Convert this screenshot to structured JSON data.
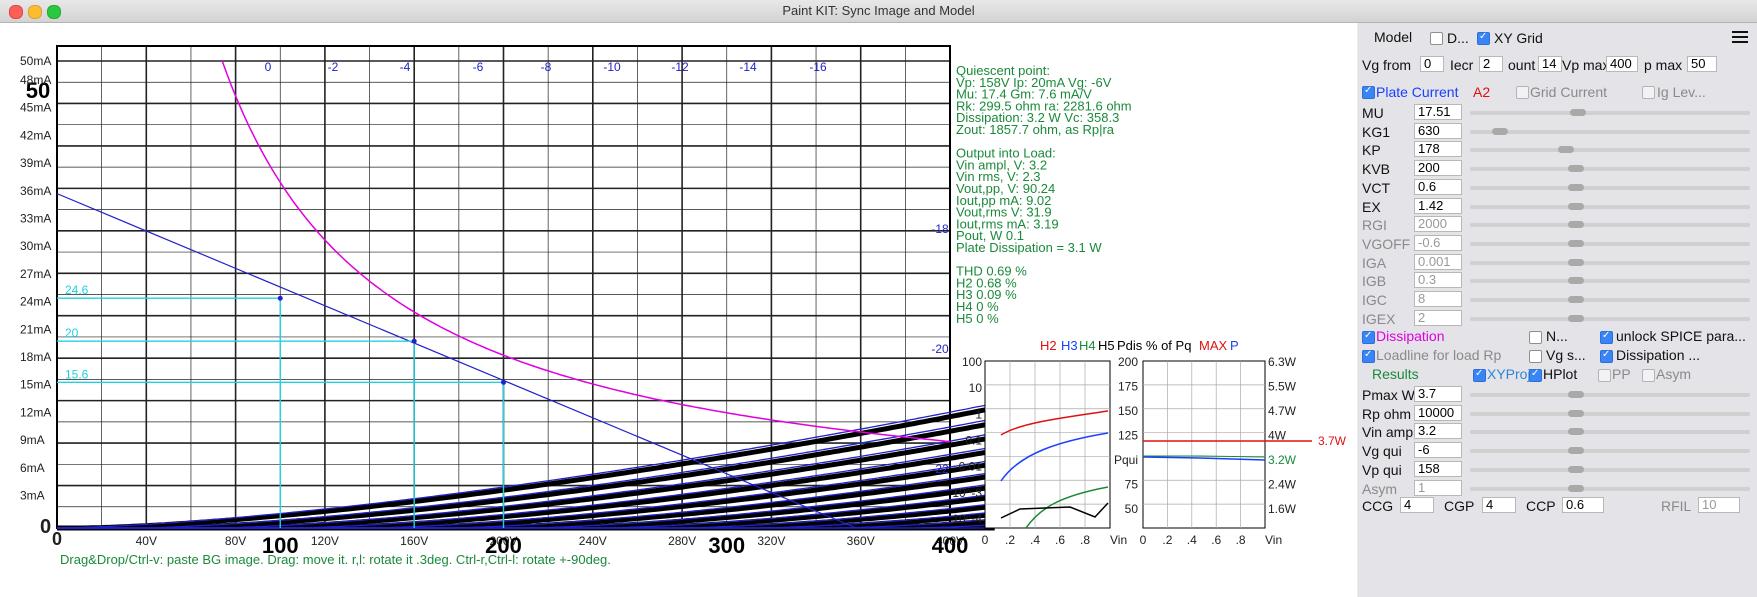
{
  "window": {
    "title": "Paint KIT: Sync Image and Model"
  },
  "plot": {
    "y_labels": [
      "50mA",
      "48mA",
      "45mA",
      "42mA",
      "39mA",
      "36mA",
      "33mA",
      "30mA",
      "27mA",
      "24mA",
      "21mA",
      "18mA",
      "15mA",
      "12mA",
      "9mA",
      "6mA",
      "3mA",
      "0"
    ],
    "x_labels": [
      "0",
      "40V",
      "80V",
      "120V",
      "160V",
      "200V",
      "240V",
      "280V",
      "320V",
      "360V",
      "400V"
    ],
    "scan_x_labels": [
      "100",
      "200",
      "300",
      "400"
    ],
    "grid_labels": [
      "0",
      "-2",
      "-4",
      "-6",
      "-8",
      "-10",
      "-12",
      "-14",
      "-16",
      "-18",
      "-20",
      "-22"
    ],
    "marker_labels": [
      "24.6",
      "20",
      "15.6"
    ],
    "scan_number": "50",
    "hint": "Drag&Drop/Ctrl-v: paste BG image. Drag: move it. r,l: rotate it .3deg. Ctrl-r,Ctrl-l: rotate +-90deg."
  },
  "info": {
    "lines": [
      "Quiescent point:",
      "Vp: 158V  Ip: 20mA  Vg: -6V",
      "Mu: 17.4 Gm: 7.6 mA/V",
      "Rk: 299.5 ohm ra: 2281.6 ohm",
      "Dissipation: 3.2 W Vc: 358.3",
      "Zout: 1857.7 ohm, as Rp|ra",
      "",
      "Output into Load:",
      "Vin ampl, V: 3.2",
      "Vin rms,  V: 2.3",
      "Vout,pp,   V: 90.24",
      "Iout,pp   mA: 9.02",
      "Vout,rms   V: 31.9",
      "Iout,rms  mA: 3.19",
      "Pout, W      0.1",
      "Plate Dissipation = 3.1 W",
      "",
      "THD 0.69 %",
      "  H2 0.68 %",
      "  H3 0.09 %",
      "  H4 0 %",
      "  H5 0 %"
    ]
  },
  "harmonics": {
    "legend": {
      "h2": "H2",
      "h3": "H3",
      "h4": "H4",
      "h5": "H5"
    },
    "y_labels": [
      "100",
      "10",
      "1",
      "0.1",
      "0.01",
      "10^-3",
      "10^-4"
    ],
    "x_labels": [
      "0",
      ".2",
      ".4",
      ".6",
      ".8",
      "Vin"
    ]
  },
  "pdis": {
    "title": "Pdis % of Pq",
    "max": "MAX",
    "p": "P",
    "left_labels": [
      "200",
      "175",
      "150",
      "125",
      "Pqui",
      "75",
      "50"
    ],
    "right_labels": [
      "6.3W",
      "5.5W",
      "4.7W",
      "4W",
      "3.2W",
      "2.4W",
      "1.6W"
    ],
    "max_value": "3.7W",
    "x_labels": [
      "0",
      ".2",
      ".4",
      ".6",
      ".8",
      "Vin"
    ]
  },
  "panel": {
    "model_label": "Model",
    "d_label": "D...",
    "xy_grid_label": "XY Grid",
    "menu_icon": "hamburger-menu-icon",
    "vg_from_label": "Vg from",
    "vg_from": "0",
    "incr_label": "Iecr",
    "incr": "2",
    "count_label": "ount",
    "count": "14",
    "vp_max_label": "Vp max",
    "vp_max": "400",
    "p_max_label": "p max",
    "p_max": "50",
    "plate_current": "Plate Current",
    "a2": "A2",
    "grid_current": "Grid Current",
    "ig_lev": "Ig Lev...",
    "params": [
      {
        "label": "MU",
        "value": "17.51"
      },
      {
        "label": "KG1",
        "value": "630"
      },
      {
        "label": "KP",
        "value": "178"
      },
      {
        "label": "KVB",
        "value": "200"
      },
      {
        "label": "VCT",
        "value": "0.6"
      },
      {
        "label": "EX",
        "value": "1.42"
      },
      {
        "label": "RGI",
        "value": "2000"
      },
      {
        "label": "VGOFF",
        "value": "-0.6"
      },
      {
        "label": "IGA",
        "value": "0.001"
      },
      {
        "label": "IGB",
        "value": "0.3"
      },
      {
        "label": "IGC",
        "value": "8"
      },
      {
        "label": "IGEX",
        "value": "2"
      }
    ],
    "dissipation": "Dissipation",
    "n_label": "N...",
    "unlock_label": "unlock SPICE para...",
    "loadline_label": "Loadline for load Rp",
    "vg_s_label": "Vg s...",
    "dissipation2": "Dissipation ...",
    "results": "Results",
    "xyproj": "XYProj",
    "hplot": "HPlot",
    "pp": "PP",
    "asym_cb": "Asym",
    "results_params": [
      {
        "label": "Pmax W",
        "value": "3.7"
      },
      {
        "label": "Rp ohm",
        "value": "10000"
      },
      {
        "label": "Vin ampl",
        "value": "3.2"
      },
      {
        "label": "Vg qui",
        "value": "-6"
      },
      {
        "label": "Vp qui",
        "value": "158"
      },
      {
        "label": "Asym",
        "value": "1"
      }
    ],
    "ccg_label": "CCG",
    "ccg": "4",
    "cgp_label": "CGP",
    "cgp": "4",
    "ccp_label": "CCP",
    "ccp": "0.6",
    "rfil_label": "RFIL",
    "rfil": "10"
  },
  "colors": {
    "curve": "#2222cc",
    "load": "#e000e0",
    "info": "#1a8a3a",
    "cyan": "#22d0e0",
    "red": "#e01010",
    "blue_label": "#1a40ff",
    "disabled": "#8a8a8a"
  }
}
